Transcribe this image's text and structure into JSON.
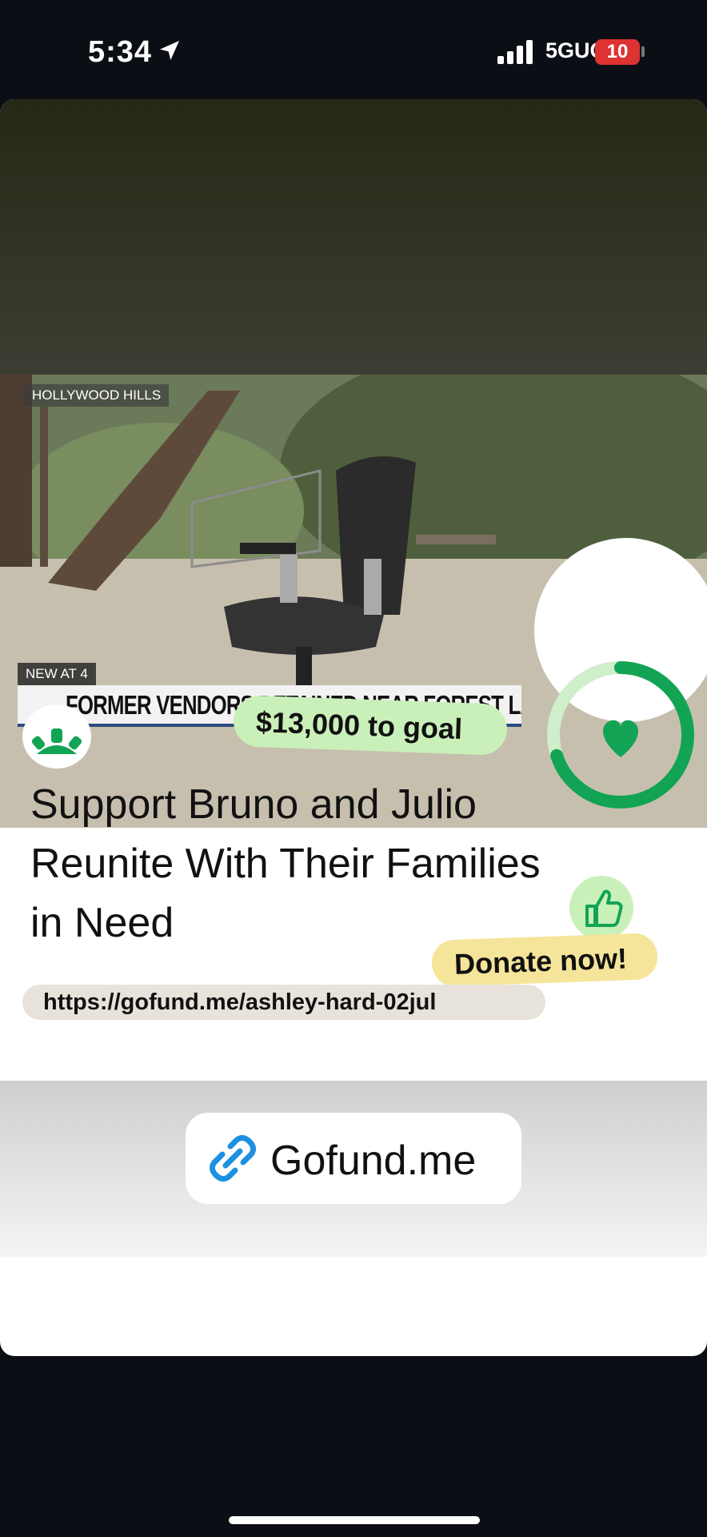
{
  "status": {
    "time": "5:34",
    "network": "5GUC",
    "battery": "10"
  },
  "video": {
    "location_tag": "HOLLYWOOD HILLS",
    "segment_tag": "NEW AT 4",
    "headline": "FORMER VENDORS DETAINED NEAR FOREST LAWN"
  },
  "campaign": {
    "goal_text": "$13,000 to goal",
    "title": "Support Bruno and Julio Reunite With Their Families in Need",
    "donate_label": "Donate now!",
    "url": "https://gofund.me/ashley-hard-02jul",
    "progress": 0.7,
    "accent": "#12a454"
  },
  "link_button": {
    "label": "Gofund.me"
  }
}
